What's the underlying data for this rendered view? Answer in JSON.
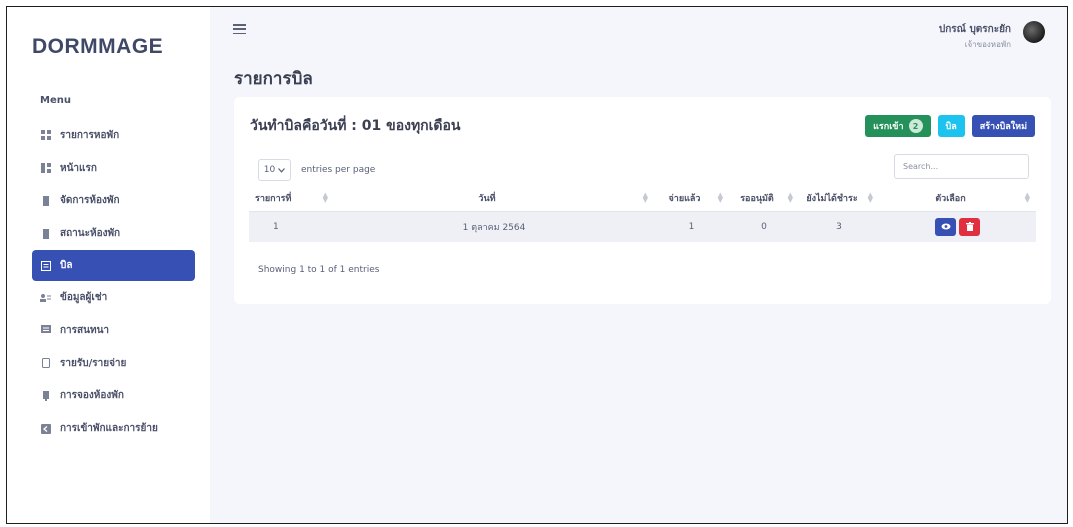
{
  "sidebar": {
    "brand": "DORMMAGE",
    "menu_heading": "Menu",
    "items": [
      {
        "label": "รายการหอพัก",
        "icon": "grid-icon"
      },
      {
        "label": "หน้าแรก",
        "icon": "dashboard-icon"
      },
      {
        "label": "จัดการห้องพัก",
        "icon": "building-icon"
      },
      {
        "label": "สถานะห้องพัก",
        "icon": "building-icon"
      },
      {
        "label": "บิล",
        "icon": "bill-icon"
      },
      {
        "label": "ข้อมูลผู้เช่า",
        "icon": "users-icon"
      },
      {
        "label": "การสนทนา",
        "icon": "chat-icon"
      },
      {
        "label": "รายรับ/รายจ่าย",
        "icon": "file-icon"
      },
      {
        "label": "การจองห้องพัก",
        "icon": "booking-icon"
      },
      {
        "label": "การเข้าพักและการย้าย",
        "icon": "move-icon"
      }
    ],
    "active_index": 4
  },
  "header": {
    "user_name": "ปกรณ์ บุตรกะยัก",
    "user_role": "เจ้าของหอพัก"
  },
  "page": {
    "title": "รายการบิล",
    "card_title": "วันทำบิลคือวันที่ : 01 ของทุกเดือน",
    "buttons": {
      "pending_label": "แรกเข้า",
      "pending_count": "2",
      "bill_label": "บิล",
      "create_label": "สร้างบิลใหม่"
    },
    "entries_value": "10",
    "entries_label": "entries per page",
    "search_placeholder": "Search...",
    "table": {
      "headers": [
        "รายการที่",
        "วันที่",
        "จ่ายแล้ว",
        "รออนุมัติ",
        "ยังไม่ได้ชำระ",
        "ตัวเลือก"
      ],
      "rows": [
        [
          "1",
          "1 ตุลาคม 2564",
          "1",
          "0",
          "3"
        ]
      ]
    },
    "showing": "Showing 1 to 1 of 1 entries"
  }
}
